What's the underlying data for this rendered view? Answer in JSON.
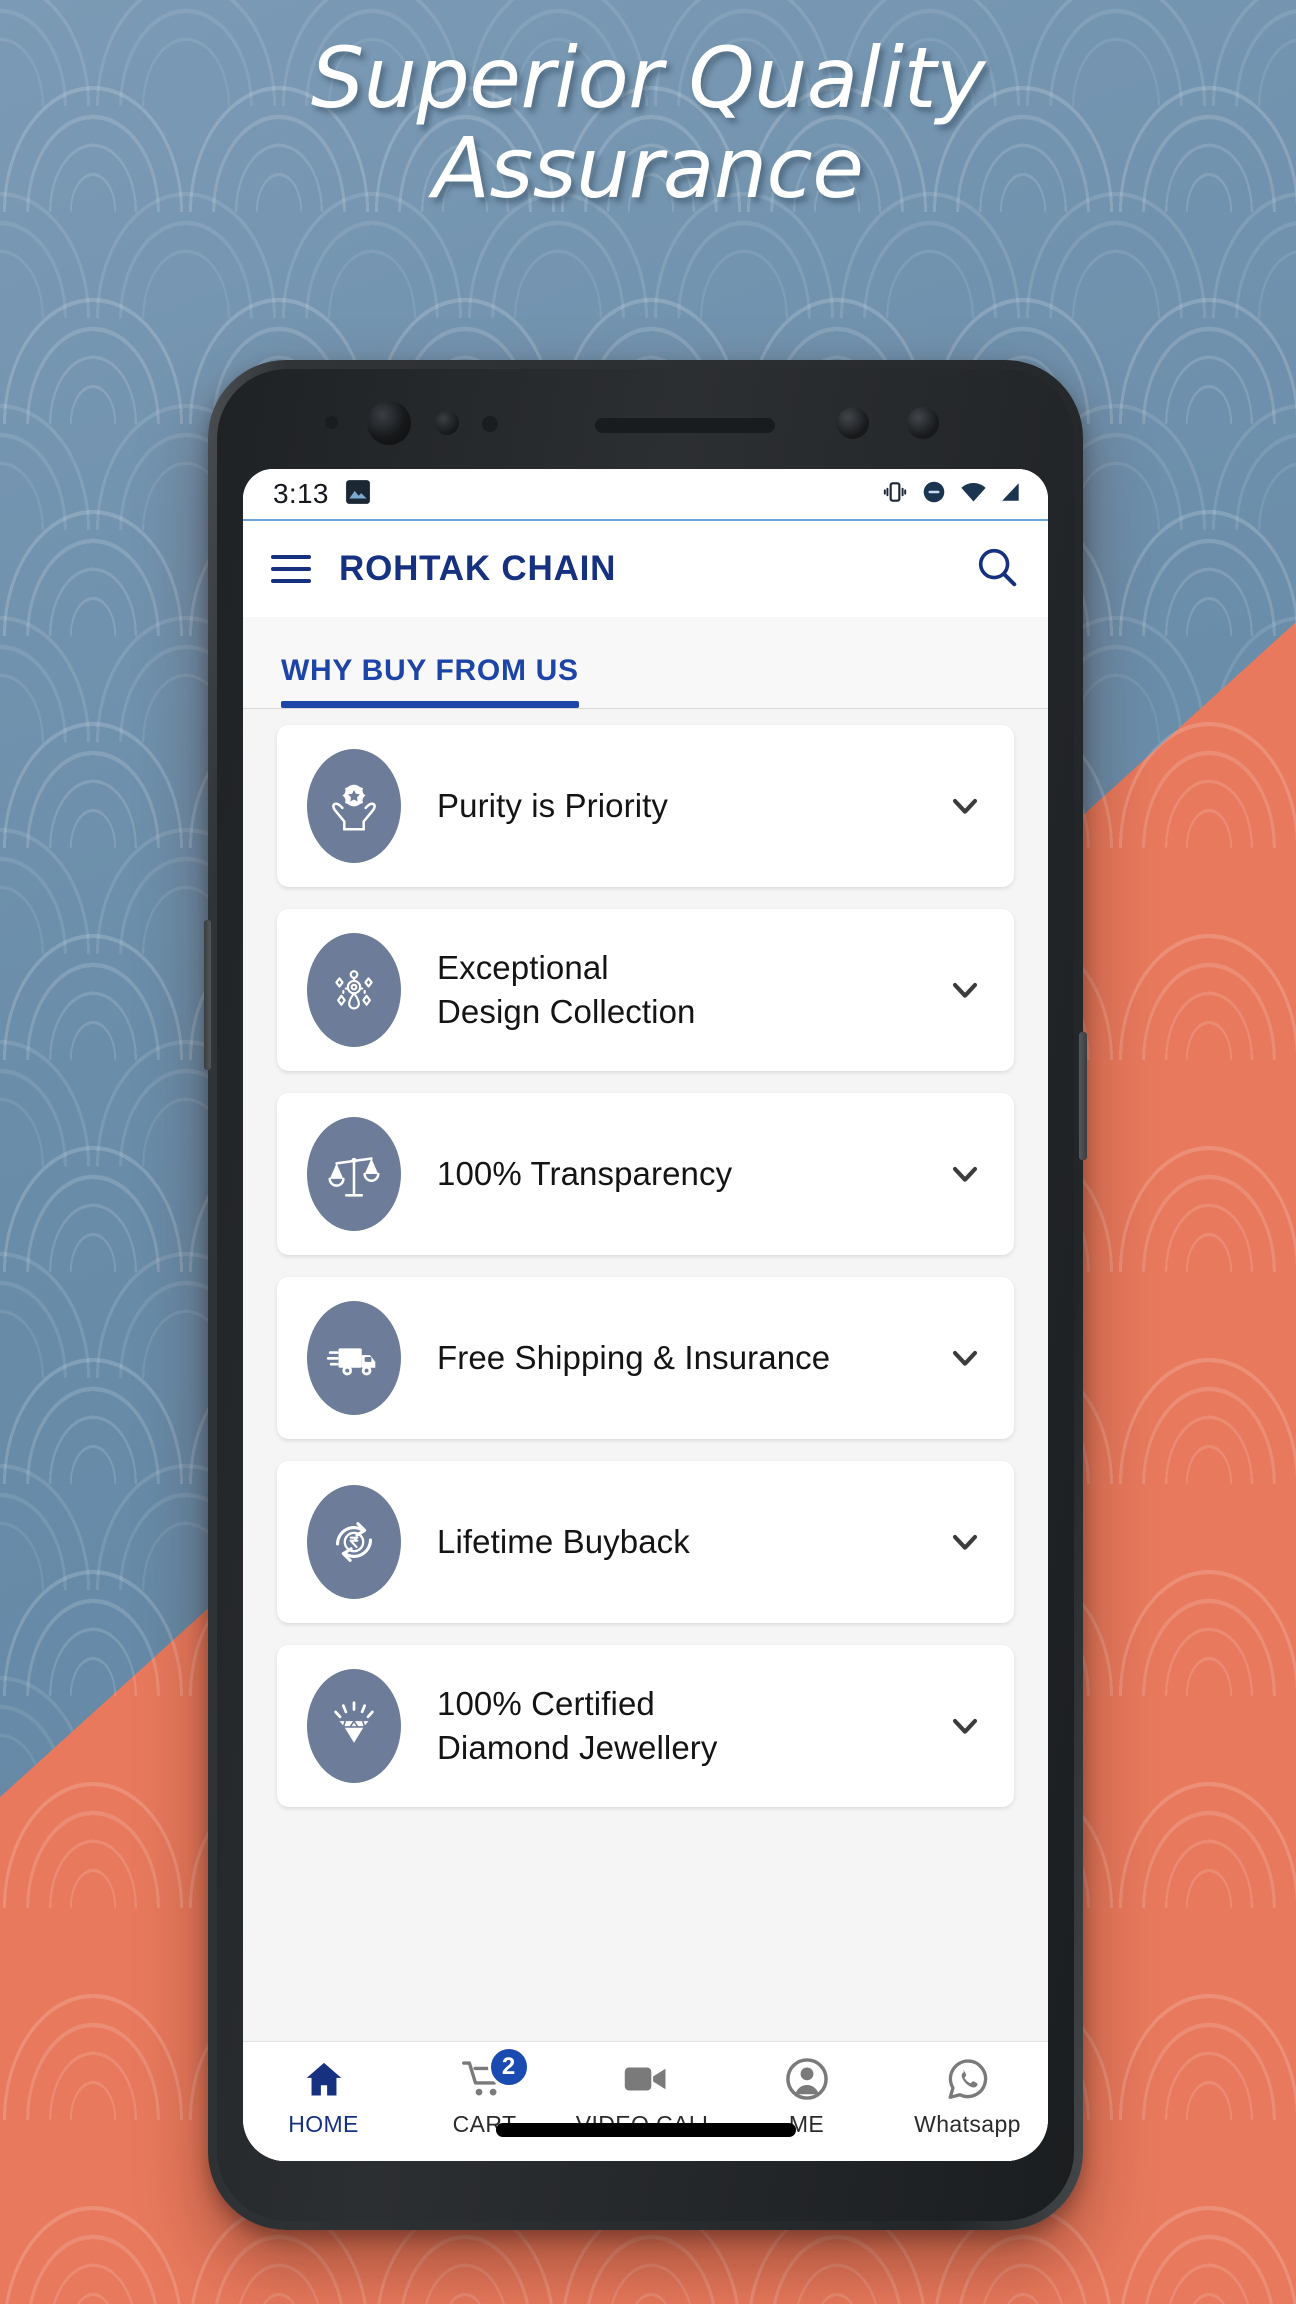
{
  "promo": {
    "headline_line1": "Superior Quality",
    "headline_line2": "Assurance",
    "bg_blue": "#6a8da9",
    "bg_coral": "#e8795c"
  },
  "statusbar": {
    "time": "3:13",
    "icons": [
      "photo-icon",
      "vibrate-icon",
      "do-not-disturb-icon",
      "wifi-icon",
      "signal-icon"
    ]
  },
  "appbar": {
    "menu_icon": "hamburger-menu-icon",
    "title": "ROHTAK CHAIN",
    "search_icon": "search-icon",
    "title_color": "#16317f"
  },
  "tabs": [
    {
      "label": "WHY BUY FROM US",
      "active": true
    }
  ],
  "list": {
    "items": [
      {
        "icon": "hands-purity-icon",
        "label": "Purity is Priority",
        "chevron": "chevron-down-icon"
      },
      {
        "icon": "jewellery-design-icon",
        "label": "Exceptional\nDesign Collection",
        "chevron": "chevron-down-icon"
      },
      {
        "icon": "balance-scale-icon",
        "label": "100% Transparency",
        "chevron": "chevron-down-icon"
      },
      {
        "icon": "delivery-truck-icon",
        "label": "Free Shipping & Insurance",
        "chevron": "chevron-down-icon"
      },
      {
        "icon": "rupee-refresh-icon",
        "label": "Lifetime Buyback",
        "chevron": "chevron-down-icon"
      },
      {
        "icon": "diamond-icon",
        "label": "100% Certified\nDiamond Jewellery",
        "chevron": "chevron-down-icon"
      }
    ],
    "icon_bg_color": "#6c7c99"
  },
  "bottomnav": {
    "items": [
      {
        "label": "HOME",
        "icon": "home-icon",
        "active": true,
        "badge": ""
      },
      {
        "label": "CART",
        "icon": "cart-icon",
        "active": false,
        "badge": "2"
      },
      {
        "label": "VIDEO CALL",
        "icon": "video-call-icon",
        "active": false,
        "badge": ""
      },
      {
        "label": "ME",
        "icon": "person-icon",
        "active": false,
        "badge": ""
      },
      {
        "label": "Whatsapp",
        "icon": "whatsapp-icon",
        "active": false,
        "badge": ""
      }
    ],
    "active_color": "#16317f",
    "badge_color": "#1a4bb0"
  }
}
